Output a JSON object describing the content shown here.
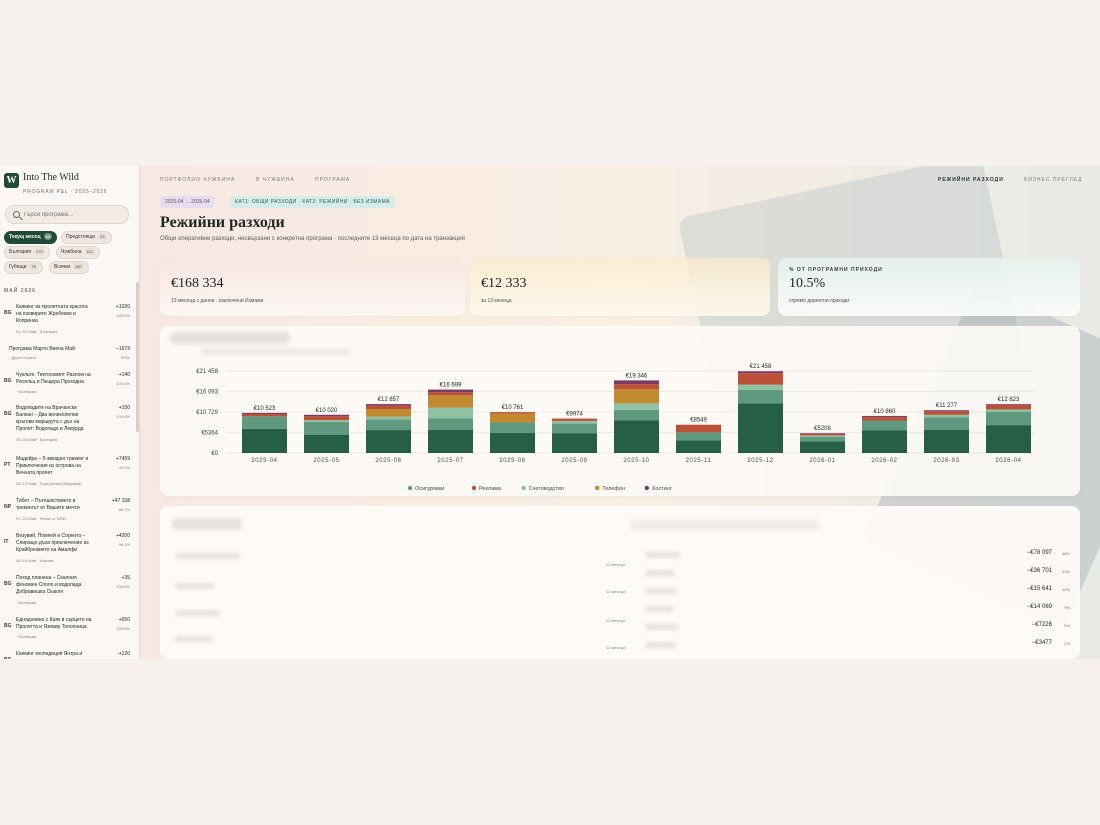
{
  "app": {
    "title": "Into The Wild",
    "subtitle": "PROGRAM P&L · 2025–2026",
    "logo_letter": "W"
  },
  "search": {
    "placeholder": "Търси програма..."
  },
  "filters": [
    {
      "label": "Текущ месец",
      "count": "23",
      "active": true
    },
    {
      "label": "Предстоящи",
      "count": "93",
      "active": false
    },
    {
      "label": "България",
      "count": "275",
      "active": false
    },
    {
      "label": "Чужбина",
      "count": "112",
      "active": false
    },
    {
      "label": "Губещи",
      "count": "76",
      "active": false
    },
    {
      "label": "Всички",
      "count": "387",
      "active": false
    }
  ],
  "sidebar": {
    "group_title": "МАЙ 2026",
    "items": [
      {
        "country": "BG",
        "title": "Каякинг из пролетната красота\nна язовирите Жребчево и\nКопринка",
        "meta": "01–02 Май · България",
        "amount": "+1020",
        "pct": "100.0%"
      },
      {
        "country": "",
        "title": "Програма Марто Виена Май",
        "meta": "· Други страни",
        "amount": "−1673",
        "pct": "0.0%"
      },
      {
        "country": "BG",
        "title": "Чукльте, Тектонският Разлом на\nРесельц и Пещера Проходна",
        "meta": "· България",
        "amount": "+140",
        "pct": "100.0%"
      },
      {
        "country": "BG",
        "title": "Водопадите на Врачански\nБалкан – Два великолепни\nкръгови маршрута с дъх на\nПролет: Водопадо и Левурда",
        "meta": "03–03 Май · България",
        "amount": "+150",
        "pct": "100.0%"
      },
      {
        "country": "PT",
        "title": "Мадейра – 5-звезден трекинг и\nПриключения из острова на\nВечната пролет",
        "meta": "06–13 Май · Португалия (Мадейра)",
        "amount": "+7459",
        "pct": "44.0%"
      },
      {
        "country": "NP",
        "title": "Тибет – Пътешествието и\nтрекингът от Вашите мечти",
        "meta": "07–23 Май · Непал и Тибет",
        "amount": "+47 158",
        "pct": "88.7%"
      },
      {
        "country": "IT",
        "title": "Везувий, Помпей и Соренто –\nСпиращо дъха приключение из\nКрайбрежието на Амалфи",
        "meta": "09–18 Май · Италия",
        "amount": "+4200",
        "pct": "96.1%"
      },
      {
        "country": "BG",
        "title": "Поход планина – Скалния\nфеномен Споло и водопада\nДобравишка Скакля",
        "meta": "· България",
        "amount": "+35",
        "pct": "100.0%"
      },
      {
        "country": "BG",
        "title": "Еднодневно с Каяк в сърцето на\nПролетта и Язовир Тополница",
        "meta": "· България",
        "amount": "+650",
        "pct": "100.0%"
      },
      {
        "country": "BG",
        "title": "Каякинг експедиция Янтра и",
        "meta": "",
        "amount": "+120",
        "pct": ""
      }
    ]
  },
  "nav": {
    "breadcrumb_1": "ПОРТФОЛИО ЧУЖБИНА",
    "breadcrumb_2": "В ЧУЖБИНА",
    "breadcrumb_3": "ПРОГРАМА",
    "right_1": "РЕЖИЙНИ РАЗХОДИ",
    "right_2": "БИЗНЕС ПРЕГЛЕД"
  },
  "page": {
    "period": "2025-04 → 2026-04",
    "tag": "КАТ1: ОБЩИ РАЗХОДИ · КАТ2: РЕЖИЙНИ · БЕЗ ИЗМАМА",
    "title": "Режийни разходи",
    "subtitle": "Общи оперативни разходи, несвързани с конкретна програма · последните 13 месеца по дата на транзакция"
  },
  "kpis": [
    {
      "label": "",
      "value": "€168 334",
      "note": "13 месеца с данни · изключени Измами"
    },
    {
      "label": "",
      "value": "€12 333",
      "note": "за 13 месеца"
    },
    {
      "label": "% ОТ ПРОГРАМНИ ПРИХОДИ",
      "value": "10.5%",
      "note": "спрямо директни приходи"
    }
  ],
  "chart_data": {
    "type": "bar",
    "categories": [
      "2025-04",
      "2025-05",
      "2025-06",
      "2025-07",
      "2025-08",
      "2025-09",
      "2025-10",
      "2025-11",
      "2025-12",
      "2026-01",
      "2026-02",
      "2026-03",
      "2026-04"
    ],
    "totals_labels": [
      "€10 523",
      "€10 020",
      "€12 857",
      "€16 699",
      "€10 761",
      "€9974",
      "€19 346",
      "€8549",
      "€21 458",
      "€5208",
      "€10 860",
      "€11 277",
      "€12 823"
    ],
    "series": [
      {
        "name": "",
        "color": "#255f46",
        "values": [
          6300,
          4800,
          6000,
          6100,
          5300,
          5200,
          8500,
          3300,
          13000,
          3000,
          5900,
          6100,
          7300
        ]
      },
      {
        "name": "Осигуровки",
        "color": "#5f997f",
        "values": [
          3300,
          3300,
          2800,
          3000,
          2700,
          2500,
          2800,
          2100,
          3500,
          1200,
          2600,
          3200,
          3500
        ]
      },
      {
        "name": "Счетоводство",
        "color": "#8ec2a3",
        "values": [
          0,
          500,
          700,
          2800,
          0,
          700,
          1700,
          0,
          1400,
          400,
          0,
          700,
          600
        ]
      },
      {
        "name": "Телефон",
        "color": "#c18a2e",
        "values": [
          0,
          0,
          2000,
          3200,
          2300,
          0,
          3700,
          0,
          0,
          0,
          0,
          0,
          0
        ]
      },
      {
        "name": "Реклама",
        "color": "#bd5137",
        "values": [
          600,
          1000,
          900,
          800,
          400,
          600,
          1300,
          2000,
          3000,
          400,
          900,
          900,
          1200
        ]
      },
      {
        "name": "Хостинг",
        "color": "#7a3b67",
        "values": [
          300,
          400,
          400,
          700,
          0,
          0,
          1000,
          0,
          500,
          200,
          300,
          300,
          200
        ]
      }
    ],
    "y_ticks": [
      "€21 458",
      "€16 093",
      "€10 729",
      "€5364",
      "€0"
    ],
    "ylim": [
      0,
      21458
    ],
    "legend": [
      "Осигуровки",
      "Реклама",
      "Счетоводство",
      "Телефон",
      "Хостинг"
    ],
    "legend_colors": [
      "#5f997f",
      "#bd5137",
      "#8ec2a3",
      "#c18a2e",
      "#7a3b67"
    ],
    "legend_position": "bottom"
  },
  "table": {
    "period_note": "12 месеца",
    "rows": [
      {
        "amount": "−€78 097",
        "pct": "48%"
      },
      {
        "amount": "−€36 701",
        "pct": "23%"
      },
      {
        "amount": "−€15 641",
        "pct": "10%"
      },
      {
        "amount": "−€14 069",
        "pct": "9%"
      },
      {
        "amount": "−€7226",
        "pct": "5%"
      },
      {
        "amount": "−€3477",
        "pct": "2%"
      }
    ]
  }
}
